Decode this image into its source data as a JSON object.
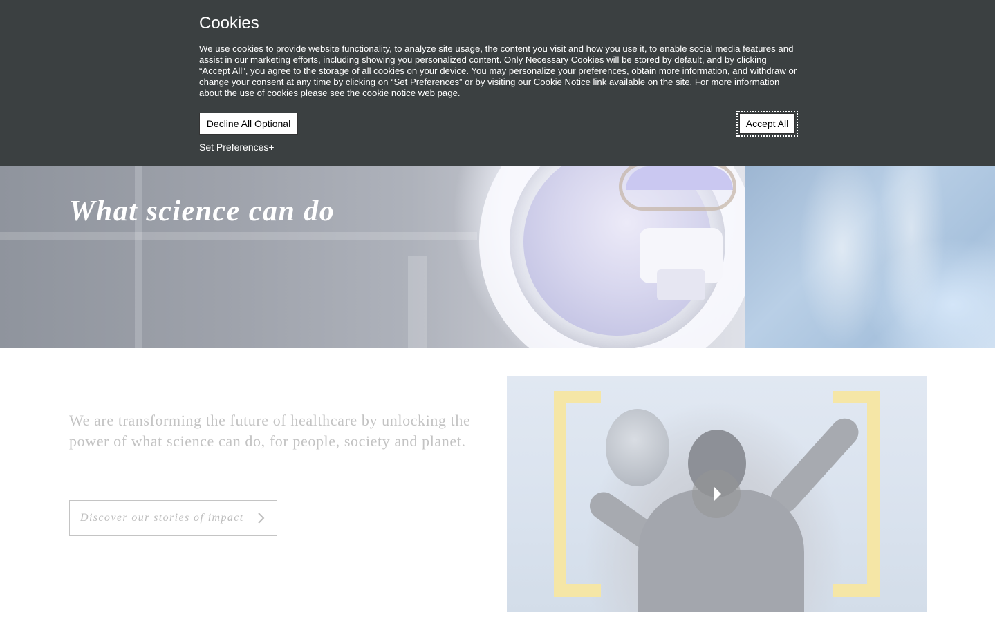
{
  "cookie_banner": {
    "title": "Cookies",
    "text_before_link": "We use cookies to provide website functionality, to analyze site usage, the content you visit and how you use it, to enable social media features and assist in our marketing efforts, including showing you personalized content. Only Necessary Cookies will be stored by default, and by clicking “Accept All”, you agree to the storage of all cookies on your device. You may personalize your preferences, obtain more information, and withdraw or change your consent at any time by clicking on “Set Preferences” or by visiting our Cookie Notice link available on the site. For more information about the use of cookies please see the ",
    "link_text": "cookie notice web page",
    "text_after_link": ".",
    "decline_label": "Decline All Optional",
    "accept_label": "Accept All",
    "preferences_label": "Set Preferences+",
    "background_color": "#3b4041"
  },
  "hero": {
    "title": "What science can do"
  },
  "intro": {
    "text": "We are transforming the future of healthcare by unlocking the power of what science can do, for people, society and planet."
  },
  "cta": {
    "label": "Discover our stories of impact",
    "icon": "chevron-right-icon"
  },
  "video": {
    "play_icon": "play-icon",
    "accent_color": "#f5e6a6"
  }
}
